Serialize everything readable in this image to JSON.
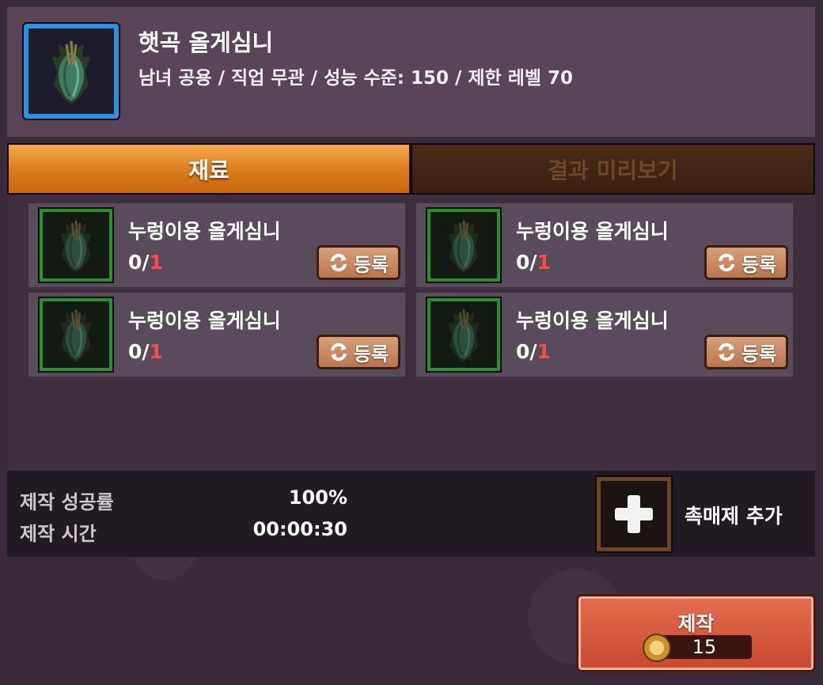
{
  "item": {
    "icon": "leaf-item-icon",
    "title": "햇곡 올게심니",
    "subtitle": "남녀 공용 / 직업 무관 / 성능 수준: 150 / 제한 레벨 70"
  },
  "tabs": {
    "materials": "재료",
    "preview": "결과 미리보기"
  },
  "materials": [
    {
      "name": "누렁이용 올게심니",
      "have": "0/",
      "need": "1",
      "button": "등록"
    },
    {
      "name": "누렁이용 올게심니",
      "have": "0/",
      "need": "1",
      "button": "등록"
    },
    {
      "name": "누렁이용 올게심니",
      "have": "0/",
      "need": "1",
      "button": "등록"
    },
    {
      "name": "누렁이용 올게심니",
      "have": "0/",
      "need": "1",
      "button": "등록"
    }
  ],
  "stats": {
    "success_label": "제작 성공률",
    "success_value": "100%",
    "time_label": "제작 시간",
    "time_value": "00:00:30"
  },
  "catalyst": {
    "label": "촉매제 추가",
    "icon": "plus-icon"
  },
  "craft": {
    "label": "제작",
    "cost": "15",
    "icon": "coin-icon"
  },
  "colors": {
    "accent_orange": "#e08a2a",
    "need_red": "#ff4a4a",
    "rare_blue": "#2f8fe0",
    "uncommon_green": "#2b8f2f"
  }
}
